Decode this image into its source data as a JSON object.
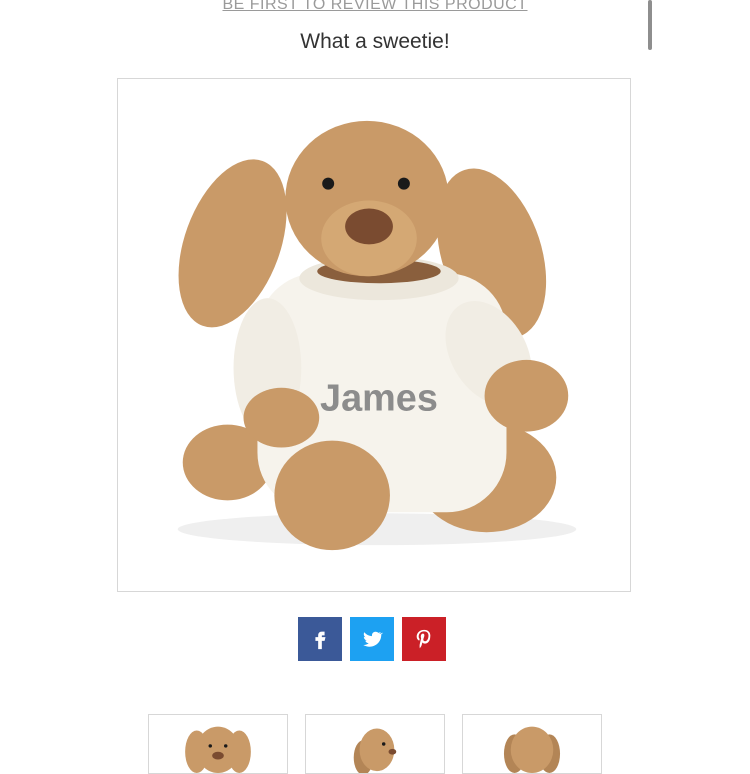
{
  "review_link": "BE FIRST TO REVIEW THIS PRODUCT",
  "tagline": "What a sweetie!",
  "product_image": {
    "sweater_text": "James",
    "colors": {
      "fur": "#c99a68",
      "fur_dark": "#a8784a",
      "sweater": "#f6f3ec",
      "nose": "#7a4b30",
      "embroidery": "#8c8c8c"
    }
  },
  "share": [
    {
      "name": "facebook",
      "icon": "facebook-icon",
      "color": "#3b5998"
    },
    {
      "name": "twitter",
      "icon": "twitter-icon",
      "color": "#1da1f2"
    },
    {
      "name": "pinterest",
      "icon": "pinterest-icon",
      "color": "#cb2027"
    }
  ],
  "thumbnails": [
    {
      "view": "front"
    },
    {
      "view": "side"
    },
    {
      "view": "back"
    }
  ]
}
